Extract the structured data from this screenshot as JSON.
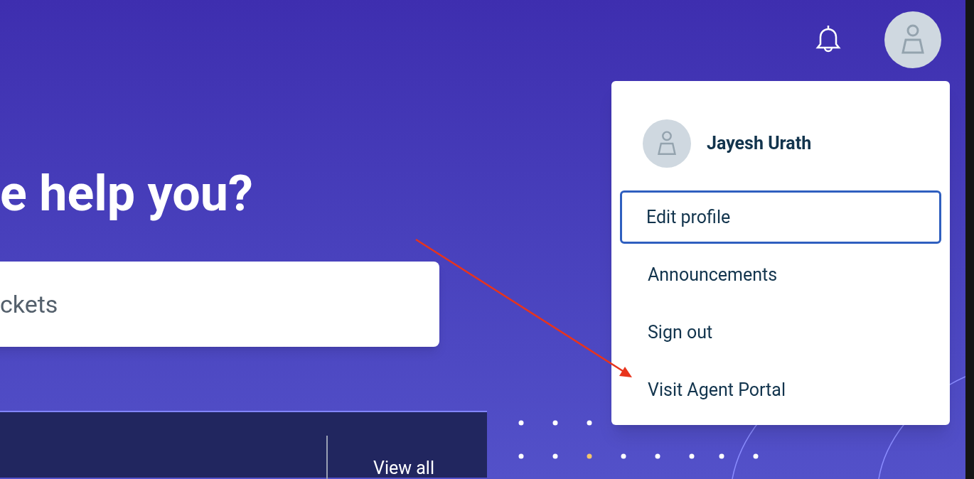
{
  "hero": {
    "heading": "e help you?",
    "search": {
      "placeholder": "ckets"
    }
  },
  "panel": {
    "link": "View all"
  },
  "profile_menu": {
    "user_name": "Jayesh Urath",
    "items": [
      {
        "label": "Edit profile",
        "selected": true
      },
      {
        "label": "Announcements",
        "selected": false
      },
      {
        "label": "Sign out",
        "selected": false
      },
      {
        "label": "Visit Agent Portal",
        "selected": false
      }
    ]
  }
}
